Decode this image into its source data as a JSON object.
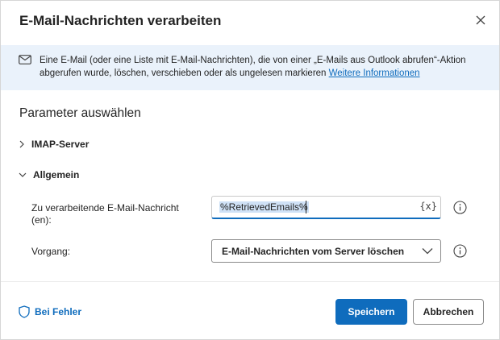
{
  "dialog": {
    "title": "E-Mail-Nachrichten verarbeiten",
    "close_icon": "close-icon"
  },
  "info": {
    "icon": "mail-icon",
    "text": "Eine E-Mail (oder eine Liste mit E-Mail-Nachrichten), die von einer „E-Mails aus Outlook abrufen“-Aktion abgerufen wurde, löschen, verschieben oder als ungelesen markieren ",
    "link": "Weitere Informationen"
  },
  "parameters": {
    "title": "Parameter auswählen",
    "sections": [
      {
        "label": "IMAP-Server",
        "expanded": false
      },
      {
        "label": "Allgemein",
        "expanded": true
      }
    ],
    "fields": {
      "message": {
        "label": "Zu verarbeitende E-Mail-Nachricht (en):",
        "value": "%RetrievedEmails%",
        "variable_button": "{x}"
      },
      "operation": {
        "label": "Vorgang:",
        "value": "E-Mail-Nachrichten vom Server löschen"
      }
    }
  },
  "footer": {
    "on_error": "Bei Fehler",
    "save": "Speichern",
    "cancel": "Abbrechen"
  },
  "colors": {
    "accent": "#0f6cbd",
    "info_background": "#eaf2fb"
  }
}
